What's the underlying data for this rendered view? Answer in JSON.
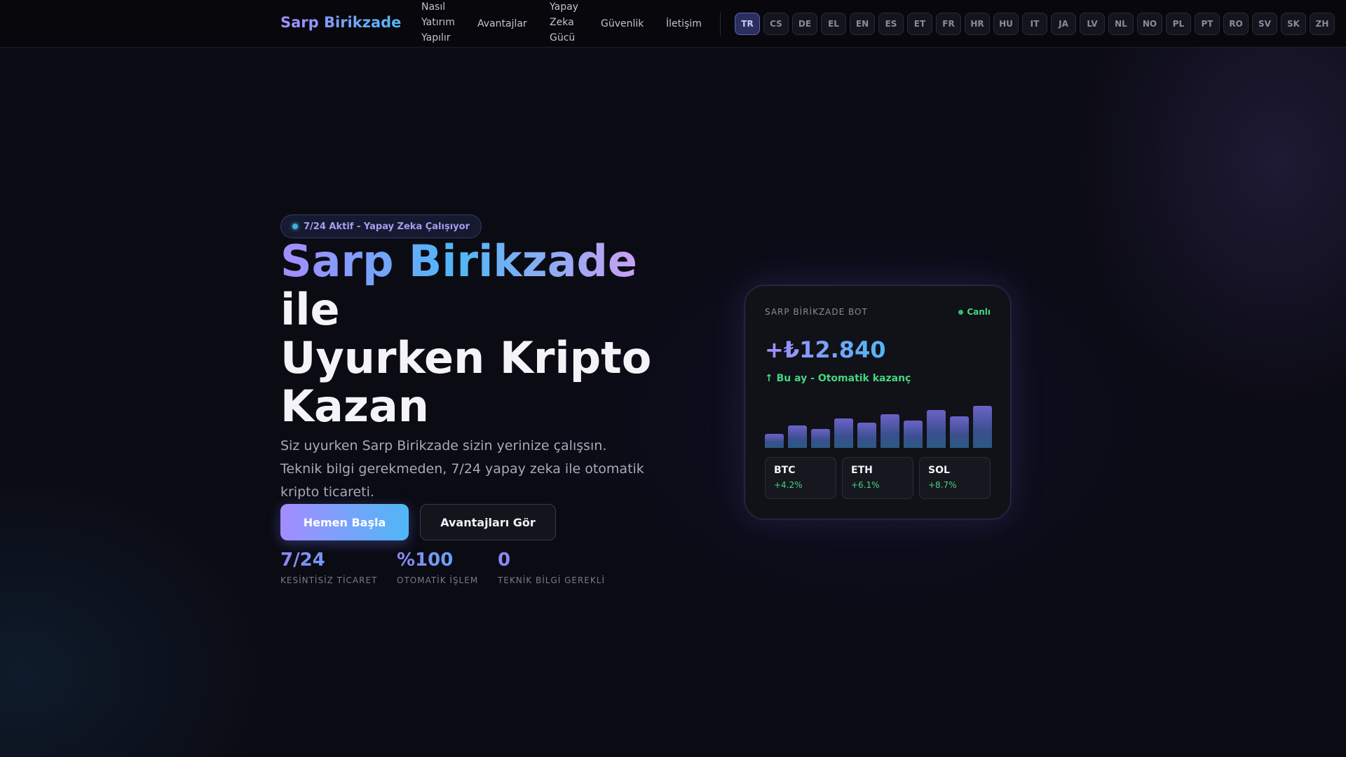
{
  "nav": {
    "brand": "Sarp Birikzade",
    "links": [
      {
        "lines": [
          "Nasıl",
          "Yatırım",
          "Yapılır"
        ]
      },
      {
        "lines": [
          "Avantajlar"
        ]
      },
      {
        "lines": [
          "Yapay",
          "Zeka",
          "Gücü"
        ]
      },
      {
        "lines": [
          "Güvenlik"
        ]
      },
      {
        "lines": [
          "İletişim"
        ]
      }
    ],
    "languages": [
      "TR",
      "CS",
      "DE",
      "EL",
      "EN",
      "ES",
      "ET",
      "FR",
      "HR",
      "HU",
      "IT",
      "JA",
      "LV",
      "NL",
      "NO",
      "PL",
      "PT",
      "RO",
      "SV",
      "SK",
      "ZH"
    ],
    "active_language": "TR"
  },
  "hero": {
    "badge": "7/24 Aktif - Yapay Zeka Çalışıyor",
    "title_highlight": "Sarp Birikzade",
    "title_line1_rest": "ile",
    "title_line2": "Uyurken Kripto",
    "title_line3": "Kazan",
    "description": "Siz uyurken Sarp Birikzade sizin yerinize çalışsın. Teknik bilgi gerekmeden, 7/24 yapay zeka ile otomatik kripto ticareti.",
    "primary_button": "Hemen Başla",
    "secondary_button": "Avantajları Gör",
    "stats": [
      {
        "value": "7/24",
        "label": "KESİNTİSİZ TİCARET"
      },
      {
        "value": "%100",
        "label": "OTOMATİK İŞLEM"
      },
      {
        "value": "0",
        "label": "TEKNİK BİLGİ GEREKLİ"
      }
    ]
  },
  "bot_card": {
    "title": "SARP BİRİKZADE BOT",
    "status": "Canlı",
    "amount": "+₺12.840",
    "subtitle": "↑ Bu ay - Otomatik kazanç",
    "bar_levels": [
      0.34,
      0.54,
      0.45,
      0.7,
      0.6,
      0.8,
      0.65,
      0.9,
      0.75,
      1.0
    ],
    "coins": [
      {
        "name": "BTC",
        "change": "+4.2%"
      },
      {
        "name": "ETH",
        "change": "+6.1%"
      },
      {
        "name": "SOL",
        "change": "+8.7%"
      }
    ],
    "colors": {
      "positive": "#43d680",
      "accent_start": "#a48cff",
      "accent_end": "#4fb7f5"
    }
  }
}
